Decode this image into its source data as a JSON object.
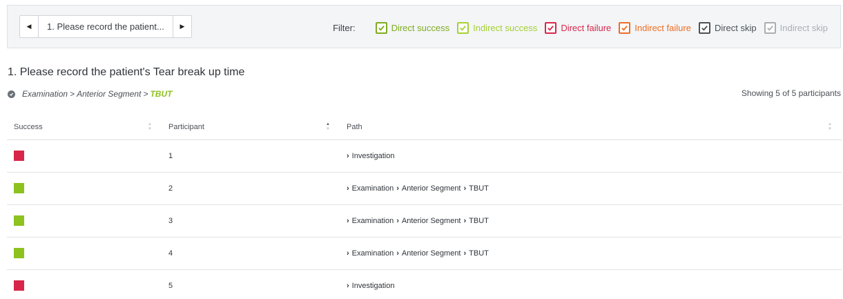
{
  "nav": {
    "prev_icon": "chevron-left-icon",
    "next_icon": "chevron-right-icon",
    "current_question": "1. Please record the patient..."
  },
  "filters": {
    "label": "Filter:",
    "items": [
      {
        "label": "Direct success",
        "color": "#7fab1f"
      },
      {
        "label": "Indirect success",
        "color": "#a6d033"
      },
      {
        "label": "Direct failure",
        "color": "#d8264a"
      },
      {
        "label": "Indirect failure",
        "color": "#ee6d23"
      },
      {
        "label": "Direct skip",
        "color": "#4c5157"
      },
      {
        "label": "Indirect skip",
        "color": "#a9aeb3"
      }
    ]
  },
  "question": {
    "title": "1. Please record the patient's Tear break up time",
    "crumb_1": "Examination",
    "crumb_2": "Anterior Segment",
    "crumb_target": "TBUT",
    "separator": ">"
  },
  "showing": "Showing 5 of 5 participants",
  "table": {
    "columns": [
      "Success",
      "Participant",
      "Path"
    ],
    "rows": [
      {
        "color": "#d8264a",
        "participant": "1",
        "path": [
          "Investigation"
        ]
      },
      {
        "color": "#8dc21f",
        "participant": "2",
        "path": [
          "Examination",
          "Anterior Segment",
          "TBUT"
        ]
      },
      {
        "color": "#8dc21f",
        "participant": "3",
        "path": [
          "Examination",
          "Anterior Segment",
          "TBUT"
        ]
      },
      {
        "color": "#8dc21f",
        "participant": "4",
        "path": [
          "Examination",
          "Anterior Segment",
          "TBUT"
        ]
      },
      {
        "color": "#d8264a",
        "participant": "5",
        "path": [
          "Investigation"
        ]
      }
    ]
  }
}
